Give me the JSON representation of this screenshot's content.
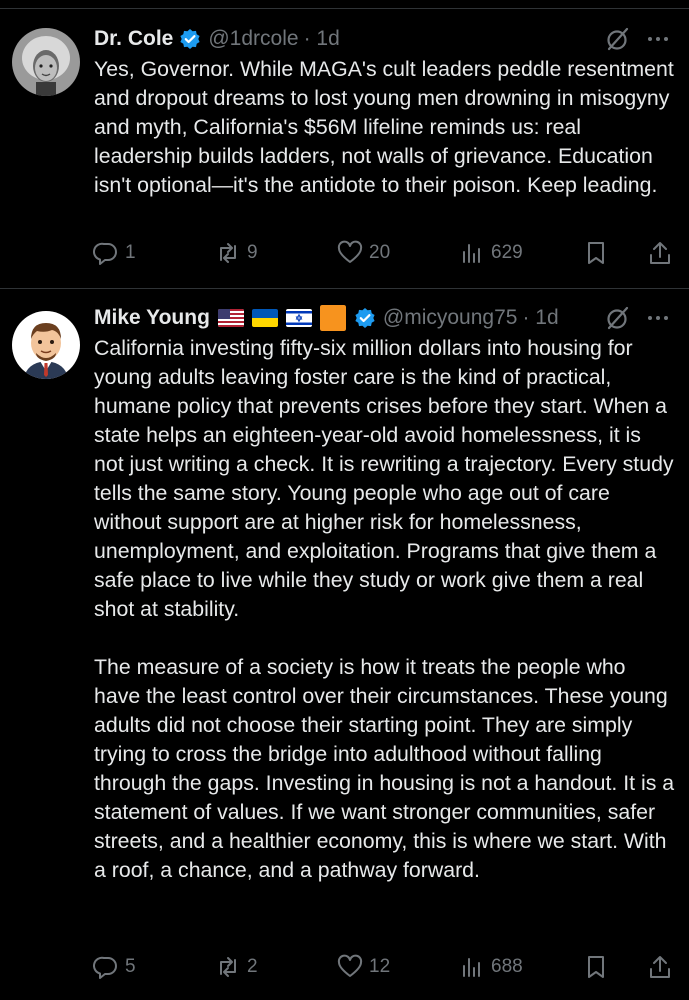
{
  "posts": [
    {
      "name": "Dr. Cole",
      "handle": "@1drcole",
      "time": "· 1d",
      "text": "Yes, Governor. While MAGA's cult leaders peddle resentment and dropout dreams to lost young men drowning in misogyny and myth, California's $56M lifeline reminds us: real leadership builds ladders, not walls of grievance. Education isn't optional—it's the antidote to their poison. Keep leading.",
      "stats": {
        "replies": "1",
        "reposts": "9",
        "likes": "20",
        "views": "629"
      }
    },
    {
      "name": "Mike Young",
      "handle": "@micyoung75",
      "time": "· 1d",
      "flags": [
        "us-flag",
        "ukraine-flag",
        "israel-flag",
        "orange-square"
      ],
      "text": "California investing fifty-six million dollars into housing for young adults leaving foster care is the kind of practical, humane policy that prevents crises before they start. When a state helps an eighteen-year-old avoid homelessness, it is not just writing a check. It is rewriting a trajectory. Every study tells the same story. Young people who age out of care without support are at higher risk for homelessness, unemployment, and exploitation. Programs that give them a safe place to live while they study or work give them a real shot at stability.\n\nThe measure of a society is how it treats the people who have the least control over their circumstances. These young adults did not choose their starting point. They are simply trying to cross the bridge into adulthood without falling through the gaps. Investing in housing is not a handout. It is a statement of values. If we want stronger communities, safer streets, and a healthier economy, this is where we start. With a roof, a chance, and a pathway forward.",
      "stats": {
        "replies": "5",
        "reposts": "2",
        "likes": "12",
        "views": "688"
      }
    }
  ],
  "colors": {
    "verified": "#1d9bf0",
    "muted": "#71767b",
    "text": "#e7e9ea",
    "divider": "#2f3336"
  }
}
